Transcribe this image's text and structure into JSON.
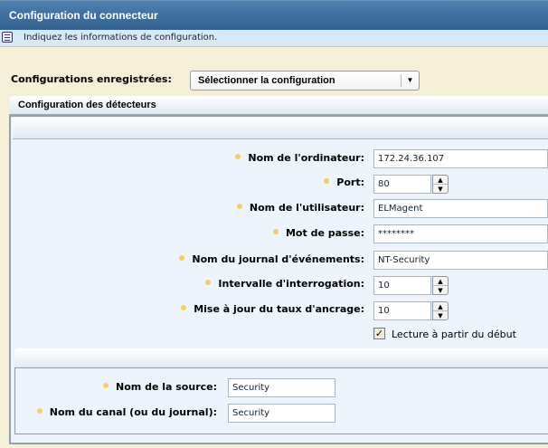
{
  "title": "Configuration du connecteur",
  "info": {
    "icon": "message-icon",
    "text": "Indiquez les informations de configuration."
  },
  "saved": {
    "label": "Configurations enregistrées:",
    "selected": "Sélectionner la configuration"
  },
  "section": {
    "title": "Configuration des détecteurs"
  },
  "fields": [
    {
      "label": "Nom de l'ordinateur:",
      "value": "172.24.36.107"
    },
    {
      "label": "Port:",
      "value": "80"
    },
    {
      "label": "Nom de l'utilisateur:",
      "value": "ELMagent"
    },
    {
      "label": "Mot de passe:",
      "value": "********"
    },
    {
      "label": "Nom du journal d'événements:",
      "value": "NT-Security"
    },
    {
      "label": "Intervalle d'interrogation:",
      "value": "10"
    },
    {
      "label": "Mise à jour du taux d'ancrage:",
      "value": "10"
    }
  ],
  "checkbox": {
    "label": "Lecture à partir du début",
    "checked": true
  },
  "source": [
    {
      "label": "Nom de la source:",
      "value": "Security"
    },
    {
      "label": "Nom du canal (ou du journal):",
      "value": "Security"
    }
  ]
}
